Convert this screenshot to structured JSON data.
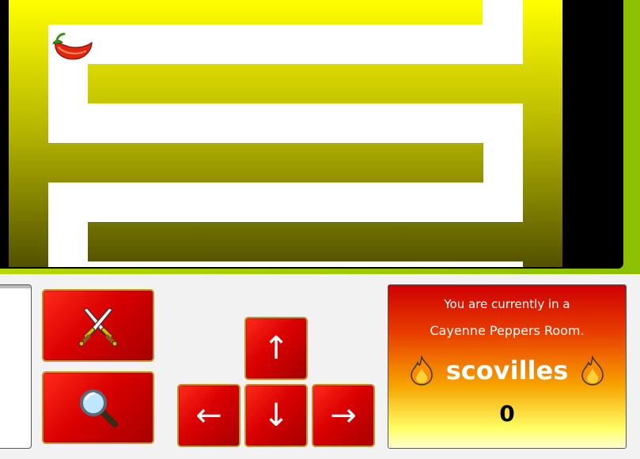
{
  "game": {
    "player_icon": "chili-pepper-icon",
    "maze_colors": {
      "wall_top": "#ffff00",
      "wall_bottom": "#525200",
      "path": "#ffffff",
      "background": "#000000"
    }
  },
  "controls": {
    "attack_icon": "crossed-swords-icon",
    "search_icon": "magnifying-glass-icon",
    "up_label": "↑",
    "left_label": "←",
    "down_label": "↓",
    "right_label": "→",
    "button_color": "#d90000",
    "button_border": "#c8912a"
  },
  "room_info": {
    "line1": "You are currently in a",
    "line2": "Cayenne Peppers Room.",
    "score_label": "scovilles",
    "score_icon": "fire-icon",
    "score_value": "0"
  }
}
